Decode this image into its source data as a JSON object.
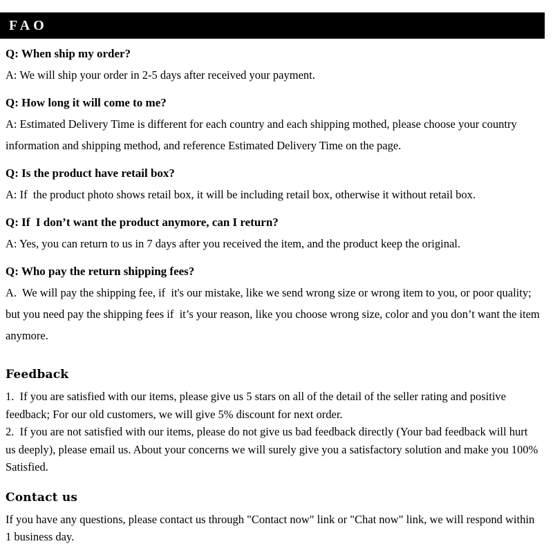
{
  "header": {
    "title": "FAO"
  },
  "faq": {
    "items": [
      {
        "question": "Q: When ship my order?",
        "answer": "A: We will ship your order in 2-5 days after received your payment."
      },
      {
        "question": "Q: How long it will come to me?",
        "answer": "A: Estimated Delivery Time is different for each country and each shipping mothed, please choose your country information and shipping method, and reference Estimated Delivery Time on the page."
      },
      {
        "question": "Q: Is the product have retail box?",
        "answer": "A: If  the product photo shows retail box, it will be including retail box, otherwise it without retail box."
      },
      {
        "question": "Q: If  I don’t want the product anymore, can I return?",
        "answer": "A: Yes, you can return to us in 7 days after you received the item, and the product keep the original."
      },
      {
        "question": "Q: Who pay the return shipping fees?",
        "answer": "A.  We will pay the shipping fee, if  it's our mistake, like we send wrong size or wrong item to you, or poor quality; but you need pay the shipping fees if  it’s your reason, like you choose wrong size, color and you don’t want the item anymore."
      }
    ]
  },
  "feedback": {
    "heading": "Feedback",
    "items": [
      "1.  If you are satisfied with our items, please give us 5 stars on all of the detail of the seller rating and positive feedback; For our old customers, we will give 5% discount for next order.",
      "2.  If you are not satisfied with our items, please do not give us bad feedback directly (Your bad feedback will hurt us deeply), please email us. About your concerns we will surely give you a satisfactory solution and make you 100% Satisfied."
    ]
  },
  "contact": {
    "heading": "Contact us",
    "body": "If you have any questions, please contact us through \"Contact now\" link or \"Chat now\" link, we will respond within 1 business day."
  },
  "colors": {
    "header_background": "#000000",
    "header_text": "#ffffff",
    "page_background": "#ffffff",
    "body_text": "#000000"
  }
}
